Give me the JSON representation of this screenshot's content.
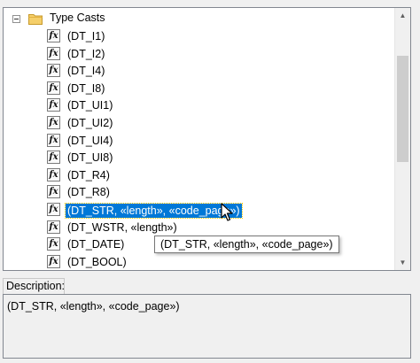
{
  "tree": {
    "root": {
      "label": "Type Casts",
      "expanded": true
    },
    "items": [
      {
        "label": "(DT_I1)",
        "icon": "function-icon"
      },
      {
        "label": "(DT_I2)",
        "icon": "function-icon"
      },
      {
        "label": "(DT_I4)",
        "icon": "function-icon"
      },
      {
        "label": "(DT_I8)",
        "icon": "function-icon"
      },
      {
        "label": "(DT_UI1)",
        "icon": "function-icon"
      },
      {
        "label": "(DT_UI2)",
        "icon": "function-icon"
      },
      {
        "label": "(DT_UI4)",
        "icon": "function-icon"
      },
      {
        "label": "(DT_UI8)",
        "icon": "function-icon"
      },
      {
        "label": "(DT_R4)",
        "icon": "function-icon"
      },
      {
        "label": "(DT_R8)",
        "icon": "function-icon"
      },
      {
        "label": "(DT_STR, «length», «code_page»)",
        "icon": "function-icon",
        "selected": true
      },
      {
        "label": "(DT_WSTR, «length»)",
        "icon": "function-icon"
      },
      {
        "label": "(DT_DATE)",
        "icon": "function-icon"
      },
      {
        "label": "(DT_BOOL)",
        "icon": "function-icon"
      }
    ],
    "icon_text": "fx"
  },
  "tooltip": {
    "text": "(DT_STR, «length», «code_page»)"
  },
  "description": {
    "tab_label": "Description:",
    "text": "(DT_STR, «length», «code_page»)"
  },
  "colors": {
    "selection": "#0078d7",
    "folder": "#e8b84a"
  }
}
